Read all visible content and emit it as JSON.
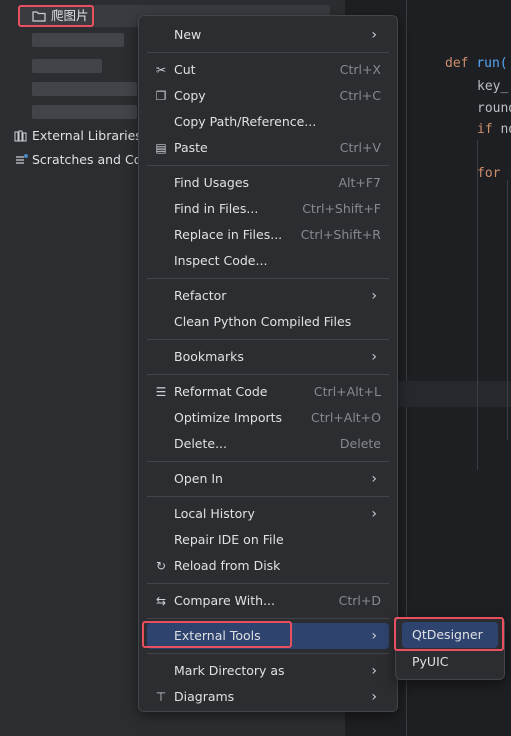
{
  "project_tree": {
    "selected_folder": "爬图片",
    "external_libraries": "External Libraries",
    "scratches": "Scratches and Con"
  },
  "code": {
    "line1_keyword": "def",
    "line1_fn": "run(",
    "line2": "key_",
    "line3": "round",
    "line4_keyword": "if",
    "line4_rest": " no",
    "line5_keyword": "for",
    "line5_rest": " ("
  },
  "context_menu": {
    "items": [
      {
        "label": "New",
        "shortcut": "",
        "icon": "",
        "submenu": true
      },
      {
        "label": "Cut",
        "shortcut": "Ctrl+X",
        "icon": "scissors-icon"
      },
      {
        "label": "Copy",
        "shortcut": "Ctrl+C",
        "icon": "copy-icon"
      },
      {
        "label": "Copy Path/Reference...",
        "shortcut": ""
      },
      {
        "label": "Paste",
        "shortcut": "Ctrl+V",
        "icon": "paste-icon"
      },
      {
        "label": "Find Usages",
        "shortcut": "Alt+F7"
      },
      {
        "label": "Find in Files...",
        "shortcut": "Ctrl+Shift+F"
      },
      {
        "label": "Replace in Files...",
        "shortcut": "Ctrl+Shift+R"
      },
      {
        "label": "Inspect Code...",
        "shortcut": ""
      },
      {
        "label": "Refactor",
        "shortcut": "",
        "submenu": true
      },
      {
        "label": "Clean Python Compiled Files",
        "shortcut": ""
      },
      {
        "label": "Bookmarks",
        "shortcut": "",
        "submenu": true
      },
      {
        "label": "Reformat Code",
        "shortcut": "Ctrl+Alt+L",
        "icon": "reformat-icon"
      },
      {
        "label": "Optimize Imports",
        "shortcut": "Ctrl+Alt+O"
      },
      {
        "label": "Delete...",
        "shortcut": "Delete"
      },
      {
        "label": "Open In",
        "shortcut": "",
        "submenu": true
      },
      {
        "label": "Local History",
        "shortcut": "",
        "submenu": true
      },
      {
        "label": "Repair IDE on File",
        "shortcut": ""
      },
      {
        "label": "Reload from Disk",
        "shortcut": "",
        "icon": "reload-icon"
      },
      {
        "label": "Compare With...",
        "shortcut": "Ctrl+D",
        "icon": "compare-icon"
      },
      {
        "label": "External Tools",
        "shortcut": "",
        "submenu": true,
        "selected": true
      },
      {
        "label": "Mark Directory as",
        "shortcut": "",
        "submenu": true
      },
      {
        "label": "Diagrams",
        "shortcut": "",
        "icon": "diagram-icon",
        "submenu": true
      }
    ]
  },
  "submenu": {
    "items": [
      {
        "label": "QtDesigner",
        "selected": true
      },
      {
        "label": "PyUIC"
      }
    ]
  },
  "colors": {
    "accent_highlight": "#e8505f",
    "selection": "#2e436e",
    "menu_bg": "#2b2d30",
    "editor_bg": "#1e1f22"
  }
}
